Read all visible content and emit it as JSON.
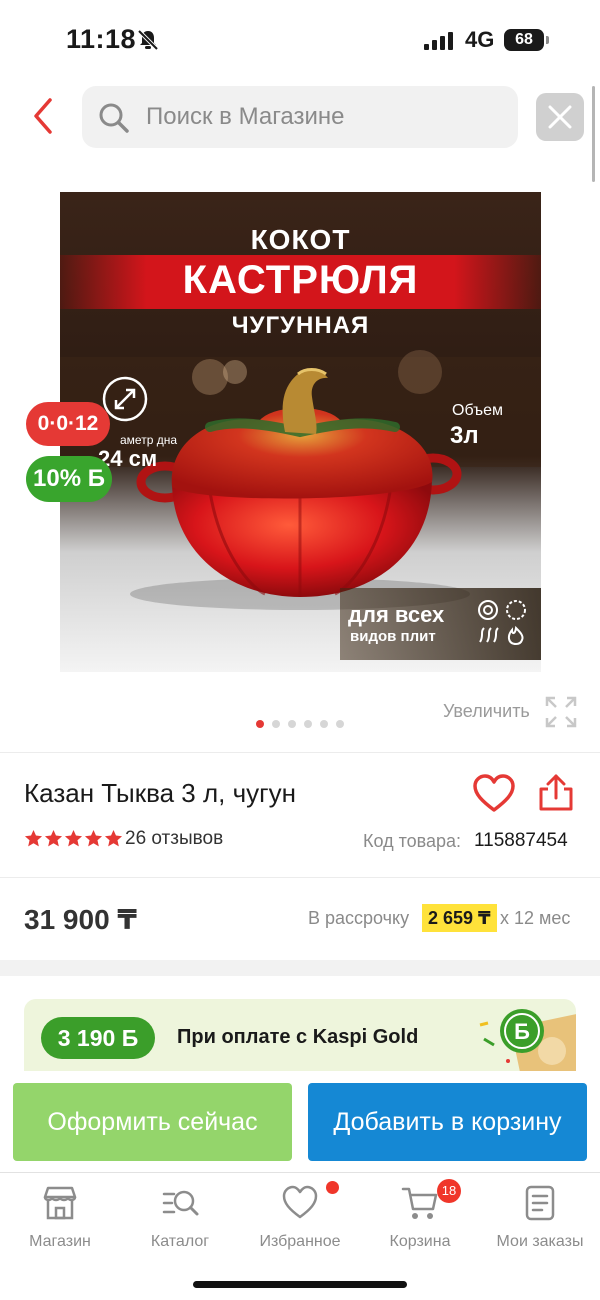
{
  "status_bar": {
    "time": "11:18",
    "network": "4G",
    "battery": "68"
  },
  "header": {
    "search_placeholder": "Поиск в Магазине"
  },
  "product_image": {
    "line1": "КОКОТ",
    "line2": "КАСТРЮЛЯ",
    "line3": "ЧУГУННАЯ",
    "diameter_label": "аметр дна",
    "diameter_value": "24 см",
    "volume_label": "Объем",
    "volume_value": "3л",
    "footer_line1": "для всех",
    "footer_line2": "видов плит"
  },
  "badges": {
    "installment": "0·0·12",
    "bonus": "10% Б"
  },
  "gallery": {
    "zoom_label": "Увеличить",
    "dot_count": 6,
    "active_dot": 0
  },
  "product": {
    "title": "Казан Тыква 3 л, чугун",
    "rating": 5,
    "reviews": "26 отзывов",
    "code_label": "Код товара:",
    "code_value": "115887454"
  },
  "price": {
    "value": "31 900 ₸",
    "installment_label": "В рассрочку",
    "installment_amount": "2 659 ₸",
    "installment_term": "x 12 мес"
  },
  "promo": {
    "bonus": "3 190 Б",
    "text": "При оплате с Kaspi Gold"
  },
  "actions": {
    "buy_now": "Оформить сейчас",
    "add_to_cart": "Добавить в корзину"
  },
  "tabbar": {
    "items": [
      {
        "label": "Магазин",
        "icon": "store-icon"
      },
      {
        "label": "Каталог",
        "icon": "catalog-search-icon"
      },
      {
        "label": "Избранное",
        "icon": "heart-icon"
      },
      {
        "label": "Корзина",
        "icon": "cart-icon"
      },
      {
        "label": "Мои заказы",
        "icon": "orders-icon"
      }
    ],
    "cart_count": "18"
  },
  "colors": {
    "accent_red": "#e53935",
    "bonus_green": "#39a52d",
    "buy_button": "#94d56b",
    "cart_button": "#1588d4",
    "installment_highlight": "#ffe23a"
  }
}
